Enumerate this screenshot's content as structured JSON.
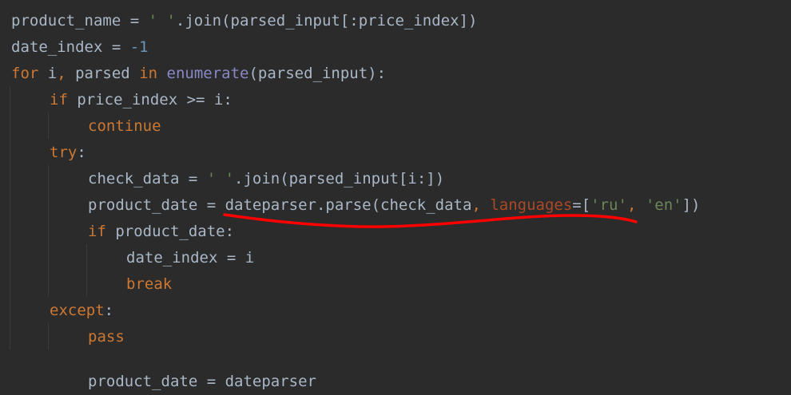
{
  "colors": {
    "background": "#2b2b2b",
    "default": "#a9b7c6",
    "keyword": "#cc7832",
    "string": "#6a8759",
    "number": "#6897bb",
    "builtin": "#8888c6",
    "param": "#aa4926",
    "annotation": "#ff0000"
  },
  "lines": [
    {
      "indent": 0,
      "tokens": [
        {
          "t": "default",
          "v": "product_name = "
        },
        {
          "t": "string",
          "v": "' '"
        },
        {
          "t": "default",
          "v": ".join(parsed_input[:price_index])"
        }
      ]
    },
    {
      "indent": 0,
      "tokens": [
        {
          "t": "default",
          "v": "date_index = "
        },
        {
          "t": "number",
          "v": "-1"
        }
      ]
    },
    {
      "indent": 0,
      "tokens": [
        {
          "t": "keyword",
          "v": "for "
        },
        {
          "t": "default",
          "v": "i"
        },
        {
          "t": "keyword",
          "v": ", "
        },
        {
          "t": "default",
          "v": "parsed "
        },
        {
          "t": "keyword",
          "v": "in "
        },
        {
          "t": "builtin",
          "v": "enumerate"
        },
        {
          "t": "default",
          "v": "(parsed_input):"
        }
      ]
    },
    {
      "indent": 1,
      "tokens": [
        {
          "t": "keyword",
          "v": "if "
        },
        {
          "t": "default",
          "v": "price_index >= i:"
        }
      ]
    },
    {
      "indent": 2,
      "tokens": [
        {
          "t": "keyword",
          "v": "continue"
        }
      ]
    },
    {
      "indent": 1,
      "tokens": [
        {
          "t": "keyword",
          "v": "try"
        },
        {
          "t": "default",
          "v": ":"
        }
      ]
    },
    {
      "indent": 2,
      "tokens": [
        {
          "t": "default",
          "v": "check_data = "
        },
        {
          "t": "string",
          "v": "' '"
        },
        {
          "t": "default",
          "v": ".join(parsed_input[i:])"
        }
      ]
    },
    {
      "indent": 2,
      "tokens": [
        {
          "t": "default",
          "v": "product_date = dateparser.parse(check_data"
        },
        {
          "t": "keyword",
          "v": ", "
        },
        {
          "t": "param",
          "v": "languages"
        },
        {
          "t": "default",
          "v": "=["
        },
        {
          "t": "string",
          "v": "'ru'"
        },
        {
          "t": "keyword",
          "v": ", "
        },
        {
          "t": "string",
          "v": "'en'"
        },
        {
          "t": "default",
          "v": "])"
        }
      ]
    },
    {
      "indent": 2,
      "tokens": [
        {
          "t": "keyword",
          "v": "if "
        },
        {
          "t": "default",
          "v": "product_date:"
        }
      ]
    },
    {
      "indent": 3,
      "tokens": [
        {
          "t": "default",
          "v": "date_index = i"
        }
      ]
    },
    {
      "indent": 3,
      "tokens": [
        {
          "t": "keyword",
          "v": "break"
        }
      ]
    },
    {
      "indent": 1,
      "tokens": [
        {
          "t": "keyword",
          "v": "except"
        },
        {
          "t": "default",
          "v": ":"
        }
      ]
    },
    {
      "indent": 2,
      "tokens": [
        {
          "t": "keyword",
          "v": "pass"
        }
      ]
    }
  ],
  "cut_line": {
    "indent": 2,
    "tokens": [
      {
        "t": "default",
        "v": "product_date = dateparser"
      }
    ]
  }
}
